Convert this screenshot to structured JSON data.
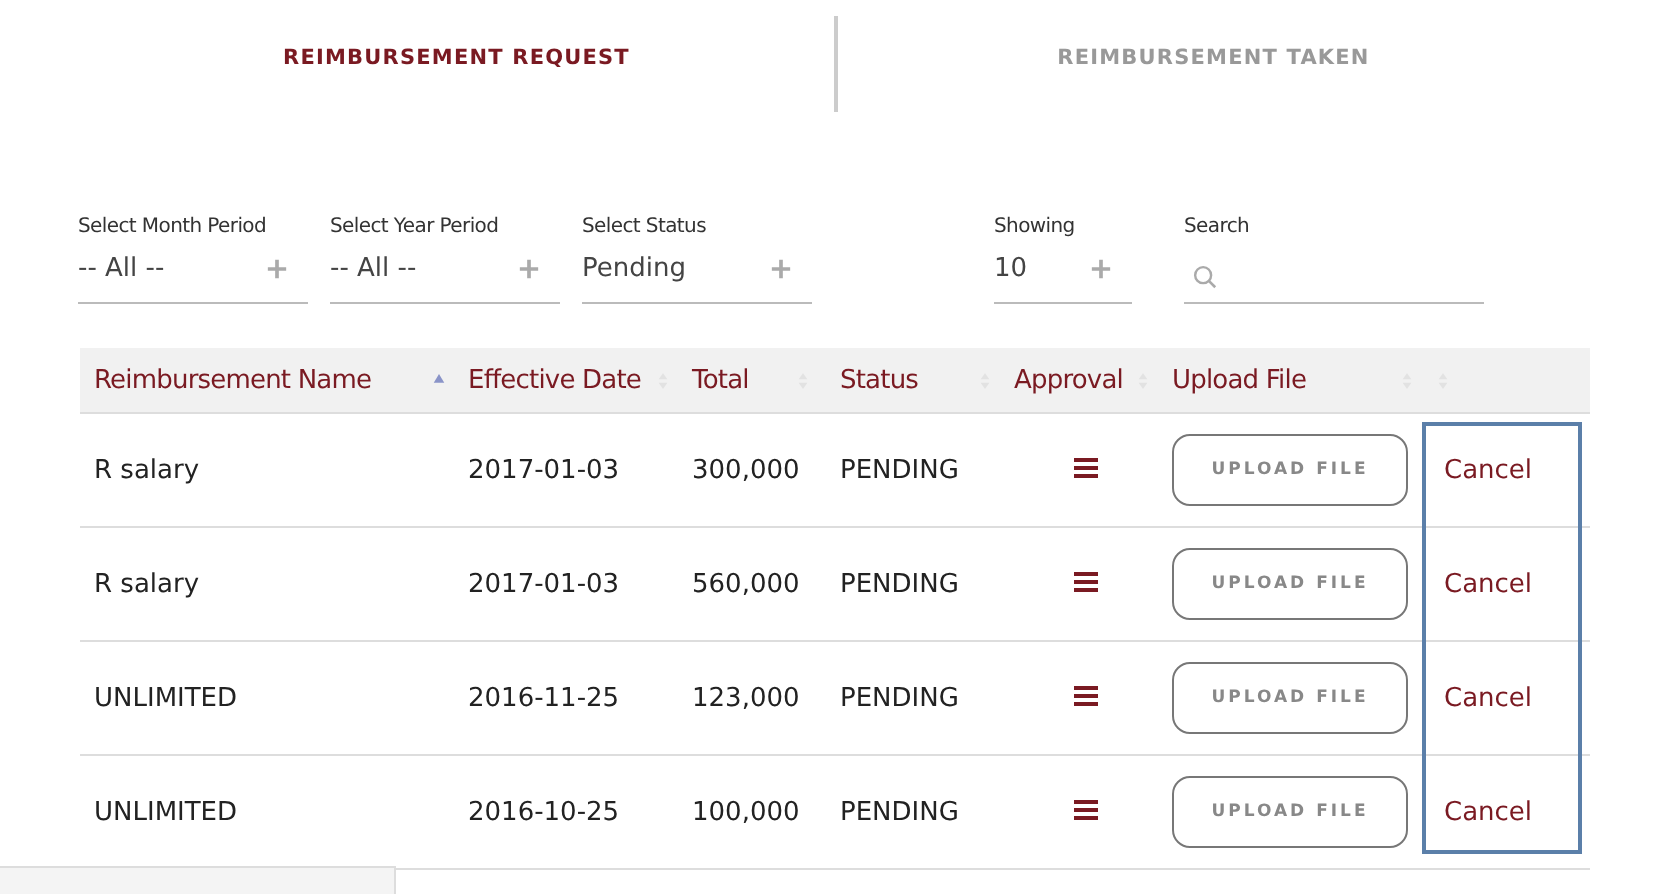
{
  "tabs": [
    {
      "label": "REIMBURSEMENT REQUEST",
      "selected": true
    },
    {
      "label": "REIMBURSEMENT TAKEN",
      "selected": false
    }
  ],
  "filters": [
    {
      "label": "Select Month Period",
      "value": "-- All --",
      "kind": "select"
    },
    {
      "label": "Select Year Period",
      "value": "-- All --",
      "kind": "select"
    },
    {
      "label": "Select Status",
      "value": "Pending",
      "kind": "select"
    },
    {
      "label": "Showing",
      "value": "10",
      "kind": "select"
    },
    {
      "label": "Search",
      "kind": "search"
    }
  ],
  "table": {
    "columns": [
      {
        "label": "Reimbursement Name",
        "sorted": true,
        "highlighted": false
      },
      {
        "label": "Effective Date",
        "sorted": false,
        "highlighted": false
      },
      {
        "label": "Total",
        "sorted": false,
        "highlighted": false
      },
      {
        "label": "Status",
        "sorted": false,
        "highlighted": false
      },
      {
        "label": "Approval",
        "sorted": false,
        "highlighted": false
      },
      {
        "label": "Upload File",
        "sorted": false,
        "highlighted": false
      },
      {
        "sorted": false,
        "highlighted": true
      }
    ],
    "rows": [
      {
        "name": "R salary",
        "date": "2017-01-03",
        "total": "300,000",
        "status": "PENDING",
        "upload": "UPLOAD FILE",
        "action": "Cancel"
      },
      {
        "name": "R salary",
        "date": "2017-01-03",
        "total": "560,000",
        "status": "PENDING",
        "upload": "UPLOAD FILE",
        "action": "Cancel"
      },
      {
        "name": "UNLIMITED",
        "date": "2016-11-25",
        "total": "123,000",
        "status": "PENDING",
        "upload": "UPLOAD FILE",
        "action": "Cancel"
      },
      {
        "name": "UNLIMITED",
        "date": "2016-10-25",
        "total": "100,000",
        "status": "PENDING",
        "upload": "UPLOAD FILE",
        "action": "Cancel"
      }
    ]
  }
}
